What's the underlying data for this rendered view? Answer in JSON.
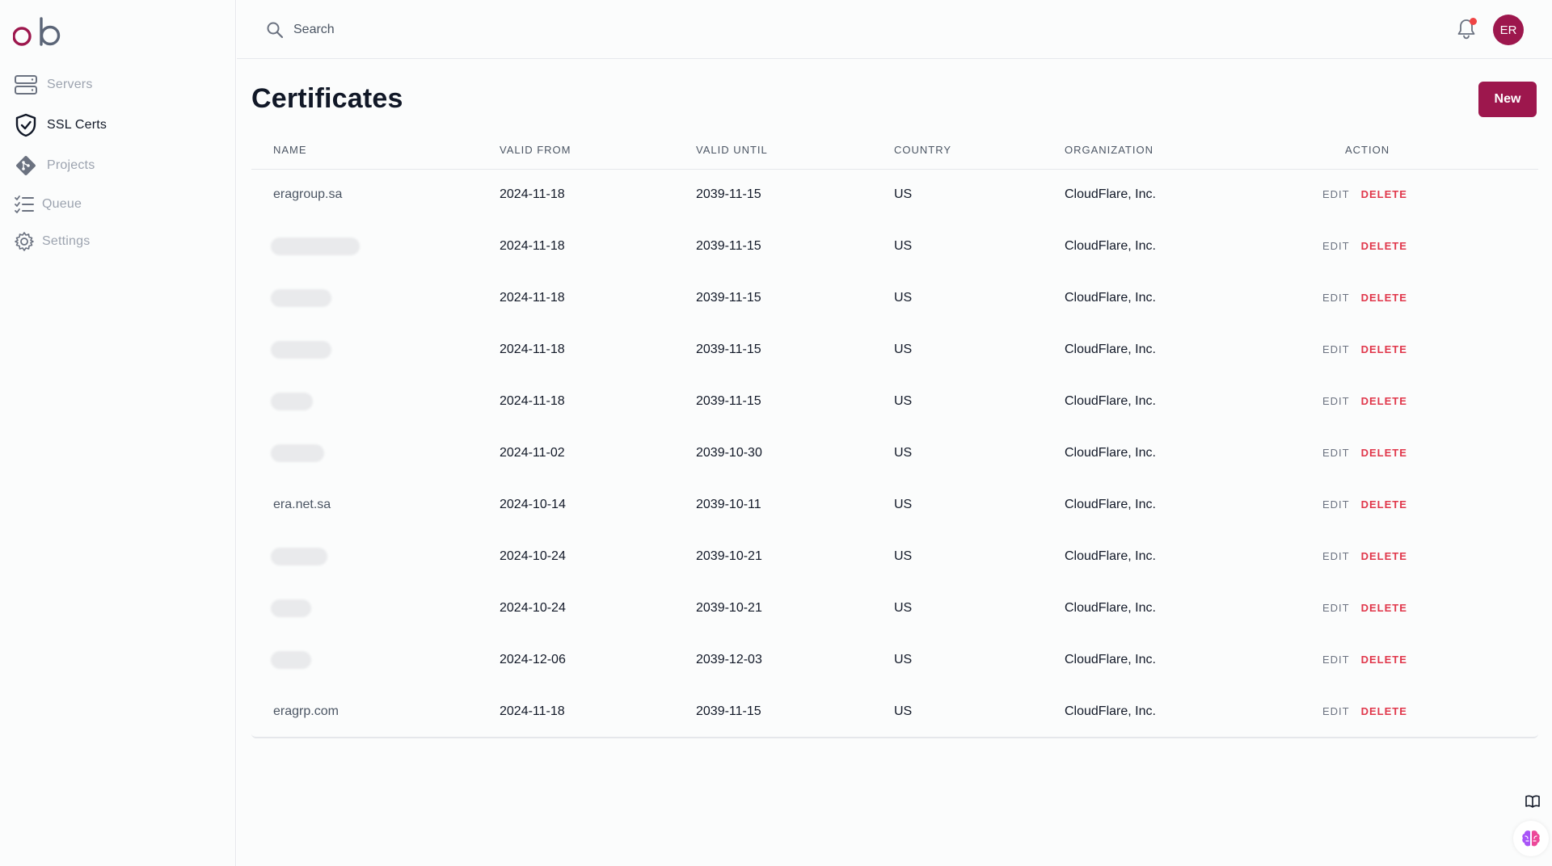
{
  "brand": {
    "logo_text": "ob",
    "accent": "#9d174d"
  },
  "sidebar": {
    "items": [
      {
        "label": "Servers",
        "icon": "servers-icon",
        "active": false
      },
      {
        "label": "SSL Certs",
        "icon": "shield-check-icon",
        "active": true
      },
      {
        "label": "Projects",
        "icon": "git-diamond-icon",
        "active": false
      },
      {
        "label": "Queue",
        "icon": "list-checks-icon",
        "active": false
      },
      {
        "label": "Settings",
        "icon": "gear-icon",
        "active": false
      }
    ]
  },
  "header": {
    "search_placeholder": "Search",
    "avatar_initials": "ER",
    "has_notification": true
  },
  "main": {
    "title": "Certificates",
    "new_label": "New",
    "table": {
      "columns": [
        "Name",
        "Valid From",
        "Valid Until",
        "Country",
        "Organization",
        "Action"
      ],
      "edit_label": "EDIT",
      "delete_label": "DELETE",
      "rows": [
        {
          "name": "eragroup.sa",
          "from": "2024-11-18",
          "until": "2039-11-15",
          "country": "US",
          "org": "CloudFlare, Inc."
        },
        {
          "name": "",
          "from": "2024-11-18",
          "until": "2039-11-15",
          "country": "US",
          "org": "CloudFlare, Inc."
        },
        {
          "name": "",
          "from": "2024-11-18",
          "until": "2039-11-15",
          "country": "US",
          "org": "CloudFlare, Inc."
        },
        {
          "name": "",
          "from": "2024-11-18",
          "until": "2039-11-15",
          "country": "US",
          "org": "CloudFlare, Inc."
        },
        {
          "name": "",
          "from": "2024-11-18",
          "until": "2039-11-15",
          "country": "US",
          "org": "CloudFlare, Inc."
        },
        {
          "name": "",
          "from": "2024-11-02",
          "until": "2039-10-30",
          "country": "US",
          "org": "CloudFlare, Inc."
        },
        {
          "name": "era.net.sa",
          "from": "2024-10-14",
          "until": "2039-10-11",
          "country": "US",
          "org": "CloudFlare, Inc."
        },
        {
          "name": "",
          "from": "2024-10-24",
          "until": "2039-10-21",
          "country": "US",
          "org": "CloudFlare, Inc."
        },
        {
          "name": "",
          "from": "2024-10-24",
          "until": "2039-10-21",
          "country": "US",
          "org": "CloudFlare, Inc."
        },
        {
          "name": "",
          "from": "2024-12-06",
          "until": "2039-12-03",
          "country": "US",
          "org": "CloudFlare, Inc."
        },
        {
          "name": "eragrp.com",
          "from": "2024-11-18",
          "until": "2039-11-15",
          "country": "US",
          "org": "CloudFlare, Inc."
        }
      ]
    }
  },
  "floating": {
    "book_icon": "book-open-icon",
    "brain_icon": "brain-icon"
  },
  "colors": {
    "delete": "#e0364a",
    "notification": "#ef4444"
  }
}
